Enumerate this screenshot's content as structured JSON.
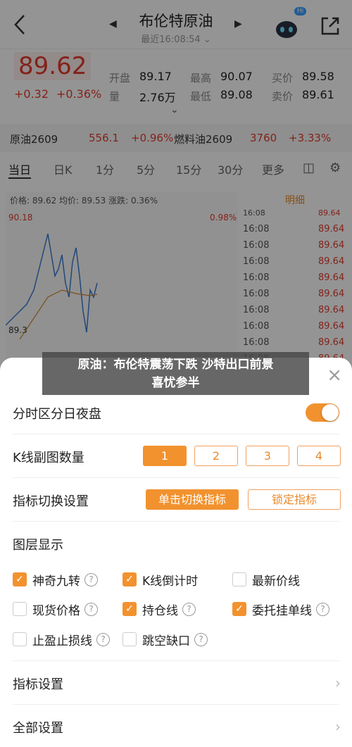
{
  "header": {
    "title": "布伦特原油",
    "subtitle": "最近16:08:54",
    "subtitle_caret": "⌄",
    "badge": "Hi"
  },
  "quote": {
    "price": "89.62",
    "change": "+0.32",
    "change_pct": "+0.36%",
    "open_label": "开盘",
    "open": "89.17",
    "high_label": "最高",
    "high": "90.07",
    "bid_label": "买价",
    "bid": "89.58",
    "volume_label": "量",
    "volume": "2.76万",
    "low_label": "最低",
    "low": "89.08",
    "ask_label": "卖价",
    "ask": "89.61"
  },
  "related": [
    {
      "name": "原油2609",
      "price": "556.1",
      "pct": "+0.96%"
    },
    {
      "name": "燃料油2609",
      "price": "3760",
      "pct": "+3.33%"
    }
  ],
  "tabs": [
    "当日",
    "日K",
    "1分",
    "5分",
    "15分",
    "30分",
    "更多"
  ],
  "chart_header": {
    "price": "价格: 89.62",
    "avg": "均价: 89.53",
    "chg": "涨跌: 0.36%",
    "detail": "明细"
  },
  "chart_labels": {
    "high": "90.18",
    "pct": "0.98%",
    "low": "89.3"
  },
  "detail_rows": [
    {
      "time": "16:08",
      "price": "89.64"
    },
    {
      "time": "16:08",
      "price": "89.64"
    },
    {
      "time": "16:08",
      "price": "89.64"
    },
    {
      "time": "16:08",
      "price": "89.64"
    },
    {
      "time": "16:08",
      "price": "89.64"
    },
    {
      "time": "16:08",
      "price": "89.64"
    },
    {
      "time": "16:08",
      "price": "89.64"
    },
    {
      "time": "16:08",
      "price": "89.64"
    },
    {
      "time": "16:08",
      "price": "89.64"
    }
  ],
  "detail_top": {
    "time": "16:08",
    "price": "89.64"
  },
  "banner": {
    "line1": "原油：布伦特震荡下跌 沙特出口前景",
    "line2": "喜忧参半"
  },
  "sheet": {
    "night_session_label": "分时区分日夜盘",
    "k_sub_label": "K线副图数量",
    "k_sub_options": [
      "1",
      "2",
      "3",
      "4"
    ],
    "indicator_switch_label": "指标切换设置",
    "indicator_switch_options": [
      "单击切换指标",
      "锁定指标"
    ],
    "layers_label": "图层显示",
    "checkboxes": [
      {
        "label": "神奇九转",
        "checked": true,
        "help": true
      },
      {
        "label": "K线倒计时",
        "checked": true,
        "help": false
      },
      {
        "label": "最新价线",
        "checked": false,
        "help": false
      },
      {
        "label": "现货价格",
        "checked": false,
        "help": true
      },
      {
        "label": "持仓线",
        "checked": true,
        "help": true
      },
      {
        "label": "委托挂单线",
        "checked": true,
        "help": true
      },
      {
        "label": "止盈止损线",
        "checked": false,
        "help": true
      },
      {
        "label": "跳空缺口",
        "checked": false,
        "help": true
      }
    ],
    "indicator_settings_label": "指标设置",
    "all_settings_label": "全部设置",
    "close": "×"
  },
  "colors": {
    "accent": "#f2922e",
    "up": "#e23b2e",
    "down": "#22943a"
  }
}
